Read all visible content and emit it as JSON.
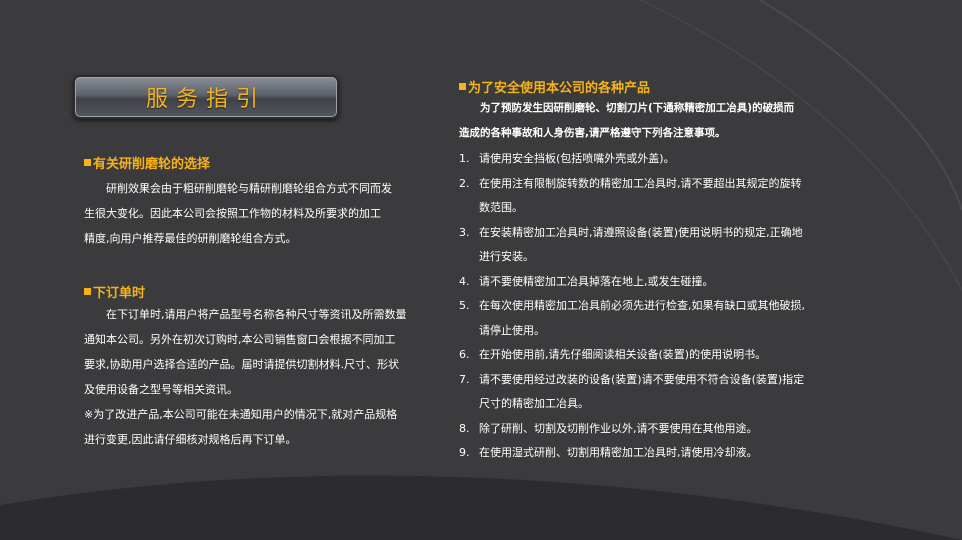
{
  "title": "服务指引",
  "left": {
    "section1": {
      "heading": "有关研削磨轮的选择",
      "lines": [
        "研削效果会由于粗研削磨轮与精研削磨轮组合方式不同而发",
        "生很大变化。因此本公司会按照工作物的材料及所要求的加工",
        "精度,向用户推荐最佳的研削磨轮组合方式。"
      ]
    },
    "section2": {
      "heading": "下订单时",
      "lines": [
        "在下订单时,请用户将产品型号名称各种尺寸等资讯及所需数量",
        "通知本公司。另外在初次订购时,本公司销售窗口会根据不同加工",
        "要求,协助用户选择合适的产品。届时请提供切割材料.尺寸、形状",
        "及使用设备之型号等相关资讯。",
        "※为了改进产品,本公司可能在未通知用户的情况下,就对产品规格",
        "进行变更,因此请仔细核对规格后再下订单。"
      ]
    }
  },
  "right": {
    "heading": "为了安全使用本公司的各种产品",
    "intro": [
      "为了预防发生因研削磨轮、切割刀片(下通称精密加工冶具)的破损而",
      "造成的各种事故和人身伤害,请严格遵守下列各注意事项。"
    ],
    "items": [
      {
        "num": "1.",
        "lines": [
          "请使用安全挡板(包括喷嘴外壳或外盖)。"
        ]
      },
      {
        "num": "2.",
        "lines": [
          "在使用注有限制旋转数的精密加工冶具时,请不要超出其规定的旋转",
          "数范围。"
        ]
      },
      {
        "num": "3.",
        "lines": [
          "在安装精密加工冶具时,请遵照设备(装置)使用说明书的规定,正确地",
          "进行安装。"
        ]
      },
      {
        "num": "4.",
        "lines": [
          "请不要使精密加工冶具掉落在地上,或发生碰撞。"
        ]
      },
      {
        "num": "5.",
        "lines": [
          "在每次使用精密加工冶具前必须先进行检查,如果有缺口或其他破损,",
          "请停止使用。"
        ]
      },
      {
        "num": "6.",
        "lines": [
          "在开始使用前,请先仔细阅读相关设备(装置)的使用说明书。"
        ]
      },
      {
        "num": "7.",
        "lines": [
          "请不要使用经过改装的设备(装置)请不要使用不符合设备(装置)指定",
          "尺寸的精密加工冶具。"
        ]
      },
      {
        "num": "8.",
        "lines": [
          "除了研削、切割及切削作业以外,请不要使用在其他用途。"
        ]
      },
      {
        "num": "9.",
        "lines": [
          "在使用湿式研削、切割用精密加工冶具时,请使用冷却液。"
        ]
      }
    ]
  }
}
